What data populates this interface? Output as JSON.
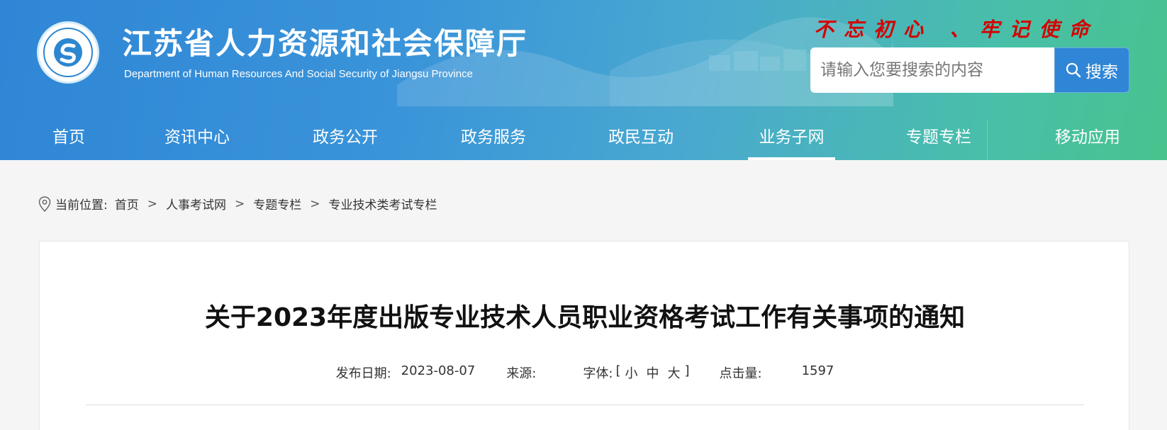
{
  "header": {
    "title": "江苏省人力资源和社会保障厅",
    "subtitle": "Department of Human Resources And Social Security of Jiangsu Province",
    "slogan": "不忘初心 、牢记使命",
    "search": {
      "placeholder": "请输入您要搜索的内容",
      "button_label": "搜索"
    },
    "colors": {
      "header_start": "#2f86d6",
      "header_end": "#47c38e",
      "slogan": "#d40000"
    }
  },
  "nav": {
    "items": [
      {
        "label": "首页"
      },
      {
        "label": "资讯中心"
      },
      {
        "label": "政务公开"
      },
      {
        "label": "政务服务"
      },
      {
        "label": "政民互动"
      },
      {
        "label": "业务子网",
        "active": true
      },
      {
        "label": "专题专栏"
      },
      {
        "label": "移动应用"
      }
    ]
  },
  "breadcrumb": {
    "prefix": "当前位置:",
    "items": [
      "首页",
      "人事考试网",
      "专题专栏",
      "专业技术类考试专栏"
    ],
    "separator": ">"
  },
  "article": {
    "title": "关于2023年度出版专业技术人员职业资格考试工作有关事项的通知",
    "publish_label": "发布日期:",
    "publish_date": "2023-08-07",
    "source_label": "来源:",
    "source_value": "",
    "font_label": "字体:",
    "font_open": "[",
    "font_small": "小",
    "font_medium": "中",
    "font_large": "大",
    "font_close": "]",
    "views_label": "点击量:",
    "views_value": "1597"
  }
}
